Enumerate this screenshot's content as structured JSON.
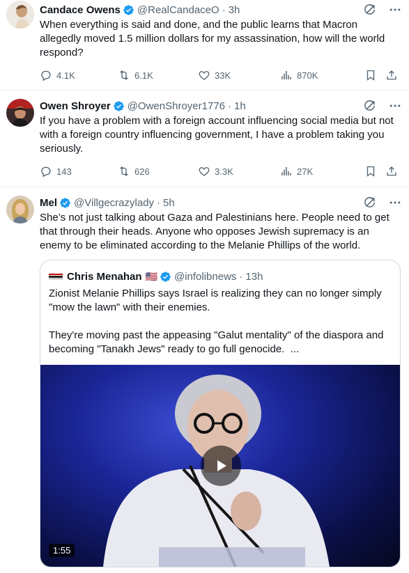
{
  "tweets": [
    {
      "name": "Candace Owens",
      "handle": "@RealCandaceO",
      "time": "3h",
      "text": "When everything is said and done, and the public learns that Macron allegedly moved 1.5 million dollars for my assassination, how will the world respond?",
      "replies": "4.1K",
      "reposts": "6.1K",
      "likes": "33K",
      "views": "870K"
    },
    {
      "name": "Owen Shroyer",
      "handle": "@OwenShroyer1776",
      "time": "1h",
      "text": "If you have a problem with a foreign account influencing social media but not with a foreign country influencing government, I have a problem taking you seriously.",
      "replies": "143",
      "reposts": "626",
      "likes": "3.3K",
      "views": "27K"
    },
    {
      "name": "Mel",
      "handle": "@Villgecrazylady",
      "time": "5h",
      "text": "She’s not just talking about Gaza and Palestinians here. People need to get that through their heads. Anyone who opposes Jewish supremacy is an enemy to be eliminated according to the Melanie Phillips of the world."
    }
  ],
  "quote": {
    "name": "Chris Menahan",
    "flag": "🇺🇸",
    "handle": "@infolibnews",
    "time": "13h",
    "text": "Zionist Melanie Phillips says Israel is realizing they can no longer simply \"mow the lawn\" with their enemies.\n\nThey're moving past the appeasing \"Galut mentality\" of the diaspora and becoming \"Tanakh Jews\" ready to go full genocide.  ...",
    "video_duration": "1:55"
  },
  "separator": "·",
  "colors": {
    "verified": "#1d9bf0",
    "secondary_text": "#536471",
    "border": "#cfd9de"
  },
  "icons": [
    "grok-icon",
    "more-icon",
    "reply-icon",
    "repost-icon",
    "like-icon",
    "views-icon",
    "bookmark-icon",
    "share-icon",
    "verified-icon",
    "play-icon"
  ]
}
